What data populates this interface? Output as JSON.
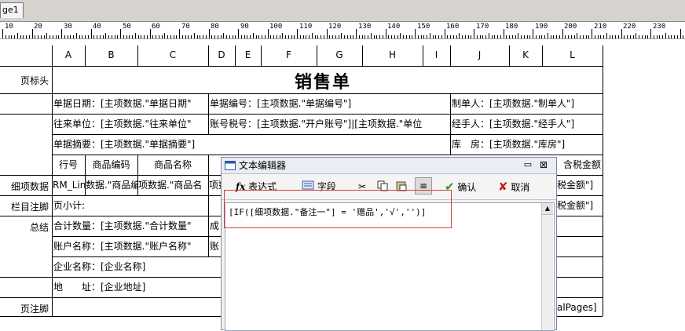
{
  "tab": {
    "label": "ge1"
  },
  "ruler": {
    "labels": [
      "10",
      "20",
      "30",
      "40",
      "50",
      "60",
      "70",
      "80",
      "90",
      "100",
      "110",
      "120",
      "130",
      "140",
      "150",
      "160",
      "170",
      "180",
      "190",
      "200",
      "210",
      "220",
      "230"
    ]
  },
  "columns": [
    "A",
    "B",
    "C",
    "D",
    "E",
    "F",
    "G",
    "H",
    "I",
    "J",
    "K",
    "L"
  ],
  "row_labels": {
    "header": "页标头",
    "detail": "细项数据",
    "column_footer": "栏目注脚",
    "total": "总结",
    "page_footer": "页注脚"
  },
  "title": "销售单",
  "cells": {
    "date": "单据日期：[主项数据.\"单据日期\"",
    "billno": "单据编号：[主项数据.\"单据编号\"]",
    "maker": "制单人：[主项数据.\"制单人\"]",
    "unit": "往来单位：[主项数据.\"往来单位\"",
    "account": "账号税号：[主项数据.\"开户账号\"]|[主项数据.\"单位",
    "handler": "经手人：[主项数据.\"经手人\"]",
    "summary": "单据摘要：[主项数据.\"单据摘要\"]",
    "store": "库　房：[主项数据.\"库房\"]",
    "h_lineno": "行号",
    "h_code": "商品编码",
    "h_name": "商品名称",
    "h_taxamt": "含税金额",
    "d_line": "RM_Lin",
    "d_code": "数据.\"商品编",
    "d_name": "项数据.\"商品名",
    "d_c4": "项数",
    "d_tax": "税金额\"]",
    "page_sub": "页小计:",
    "page_tax": "税金额\"]",
    "total_qty": "合计数量：[主项数据.\"合计数量\"",
    "total_tail": "成",
    "acct_name": "账户名称：[主项数据.\"账户名称\"",
    "acct_tail": "账",
    "company": "企业名称：[企业名称]",
    "address": "地　　址：[企业地址]",
    "pages": "alPages]"
  },
  "dialog": {
    "title": "文本编辑器",
    "toolbar": {
      "expression": "表达式",
      "field": "字段",
      "confirm": "确认",
      "cancel": "取消"
    },
    "expression_text": "[IF([细项数据.\"备注一\"] = '赠品','√','')]"
  },
  "colors": {
    "highlight_border": "#d23c3c",
    "confirm_green": "#2a9a2a",
    "cancel_red": "#c81e1e"
  }
}
